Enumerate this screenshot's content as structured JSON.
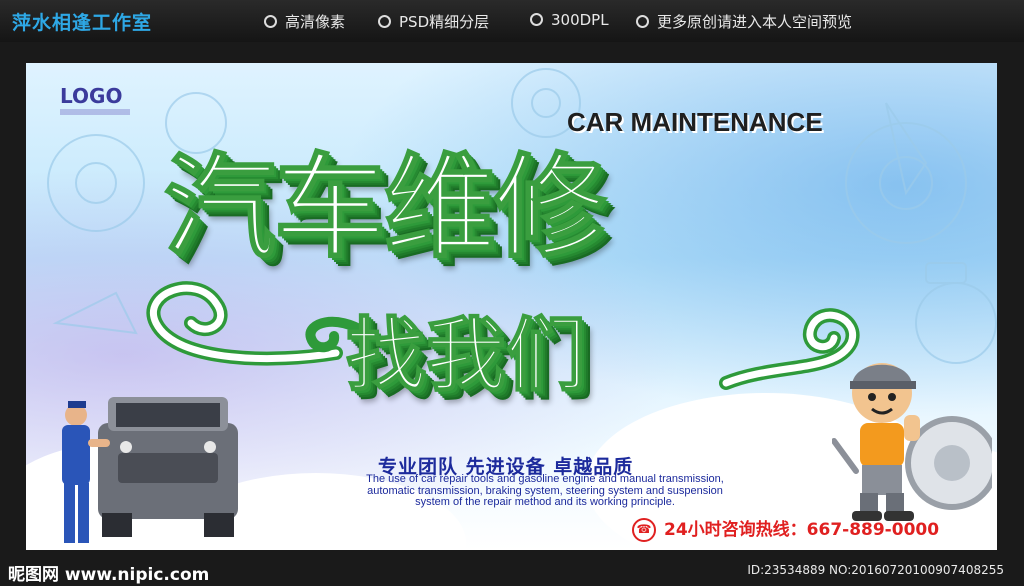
{
  "header": {
    "studio_name": "萍水相逢工作室",
    "features": [
      "高清像素",
      "PSD精细分层",
      "300DPL",
      "更多原创请进入本人空间预览"
    ]
  },
  "poster": {
    "logo": "LOGO",
    "en_title": "CAR MAINTENANCE",
    "title_line1": "汽车维修",
    "title_line2": "找我们",
    "slogan": "专业团队  先进设备  卓越品质",
    "description": "The use of car repair tools and gasoline engine and manual transmission, automatic transmission, braking system, steering system and suspension system of the repair method and its working principle.",
    "hotline": "24小时咨询热线：667-889-0000",
    "colors": {
      "title_green": "#2e9a3a",
      "slogan_blue": "#1c2a9c",
      "hotline_red": "#e02020",
      "studio_blue": "#2ea8e6"
    }
  },
  "footer": {
    "watermark_left": "昵图网 www.nipic.com",
    "watermark_right": "ID:23534889 NO:20160720100907408255"
  }
}
